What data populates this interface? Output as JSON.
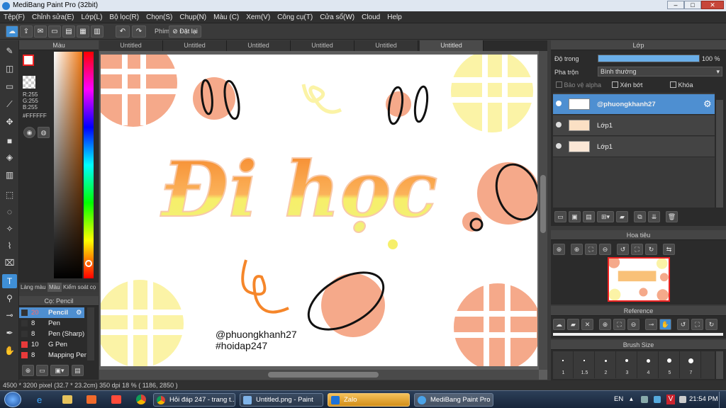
{
  "window": {
    "title": "MediBang Paint Pro (32bit)"
  },
  "menu": [
    "Tệp(F)",
    "Chỉnh sửa(E)",
    "Lớp(L)",
    "Bộ lọc(R)",
    "Chọn(S)",
    "Chụp(N)",
    "Màu (C)",
    "Xem(V)",
    "Công cụ(T)",
    "Cửa sổ(W)",
    "Cloud",
    "Help"
  ],
  "toolbar": {
    "phim_label": "Phím",
    "reset_label": "Đặt lại"
  },
  "color_panel": {
    "title": "Màu",
    "r": "R:255",
    "g": "G:255",
    "b": "B:255",
    "hex": "#FFFFFF",
    "tabs": [
      "Làng màu",
      "Màu",
      "Kiểm soát cọ"
    ]
  },
  "brush_panel": {
    "title": "Cọ: Pencil",
    "items": [
      {
        "size": "20",
        "name": "Pencil",
        "color": "#e83a3a"
      },
      {
        "size": "8",
        "name": "Pen",
        "color": "#333333"
      },
      {
        "size": "8",
        "name": "Pen (Sharp)",
        "color": "#333333"
      },
      {
        "size": "10",
        "name": "G Pen",
        "color": "#e83a3a"
      },
      {
        "size": "8",
        "name": "Mapping Pen",
        "color": "#e83a3a"
      }
    ]
  },
  "tabs": [
    "Untitled",
    "Untitled",
    "Untitled",
    "Untitled",
    "Untitled",
    "Untitled"
  ],
  "canvas": {
    "signature1": "@phuongkhanh27",
    "signature2": "#hoidap247",
    "artwork_text": "Đi học"
  },
  "layer_panel": {
    "title": "Lớp",
    "opacity_label": "Độ trong",
    "opacity_value": "100 %",
    "opacity": 1.0,
    "blend_label": "Pha trộn",
    "blend_value": "Bình thường",
    "protect_alpha": "Bảo vệ alpha",
    "clipping": "Xén bớt",
    "lock": "Khóa",
    "layers": [
      "@phuongkhanh27",
      "Lớp1",
      "Lớp1"
    ]
  },
  "navigator": {
    "title": "Hoa tiêu"
  },
  "reference": {
    "title": "Reference"
  },
  "brush_size": {
    "title": "Brush Size",
    "sizes": [
      "1",
      "1.5",
      "2",
      "3",
      "4",
      "5",
      "7"
    ]
  },
  "status": {
    "dimensions": "4500 * 3200 pixel",
    "physical": "(32.7 * 23.2cm)",
    "dpi": "350 dpi",
    "zoom": "18 %",
    "coords": "( 1186, 2850 )"
  },
  "taskbar": {
    "tasks": [
      "Hỏi đáp 247 - trang t...",
      "Untitled.png - Paint",
      "Zalo",
      "MediBang Paint Pro ..."
    ],
    "lang": "EN",
    "time": "21:54 PM"
  },
  "colors": {
    "accent": "#4e8fd1",
    "orange": "#f5a98a",
    "yellow": "#fbf3a6",
    "lettering": "#f5862a"
  }
}
